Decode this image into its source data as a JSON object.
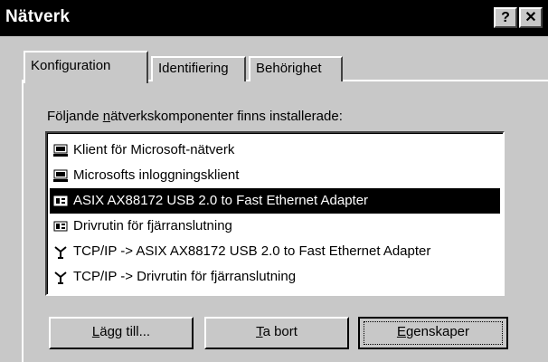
{
  "window": {
    "title": "Nätverk"
  },
  "titlebar": {
    "help_label": "?",
    "close_label": "✕"
  },
  "tabs": [
    {
      "label": "Konfiguration"
    },
    {
      "label": "Identifiering"
    },
    {
      "label": "Behörighet"
    }
  ],
  "components": {
    "label_prefix": "Följande ",
    "label_underlined": "n",
    "label_suffix": "ätverkskomponenter finns installerade:",
    "items": [
      {
        "label": "Klient för Microsoft-nätverk",
        "icon": "network-client-icon"
      },
      {
        "label": "Microsofts inloggningsklient",
        "icon": "network-client-icon"
      },
      {
        "label": "ASIX AX88172 USB 2.0 to Fast Ethernet Adapter",
        "icon": "network-adapter-icon"
      },
      {
        "label": "Drivrutin för fjärranslutning",
        "icon": "network-adapter-icon"
      },
      {
        "label": "TCP/IP -> ASIX AX88172 USB 2.0 to Fast Ethernet Adapter",
        "icon": "protocol-icon"
      },
      {
        "label": "TCP/IP -> Drivrutin för fjärranslutning",
        "icon": "protocol-icon"
      }
    ],
    "selected_index": 2
  },
  "buttons": {
    "add_u": "L",
    "add_rest": "ägg till...",
    "remove_u": "T",
    "remove_rest": "a bort",
    "props_u": "E",
    "props_rest": "genskaper"
  }
}
